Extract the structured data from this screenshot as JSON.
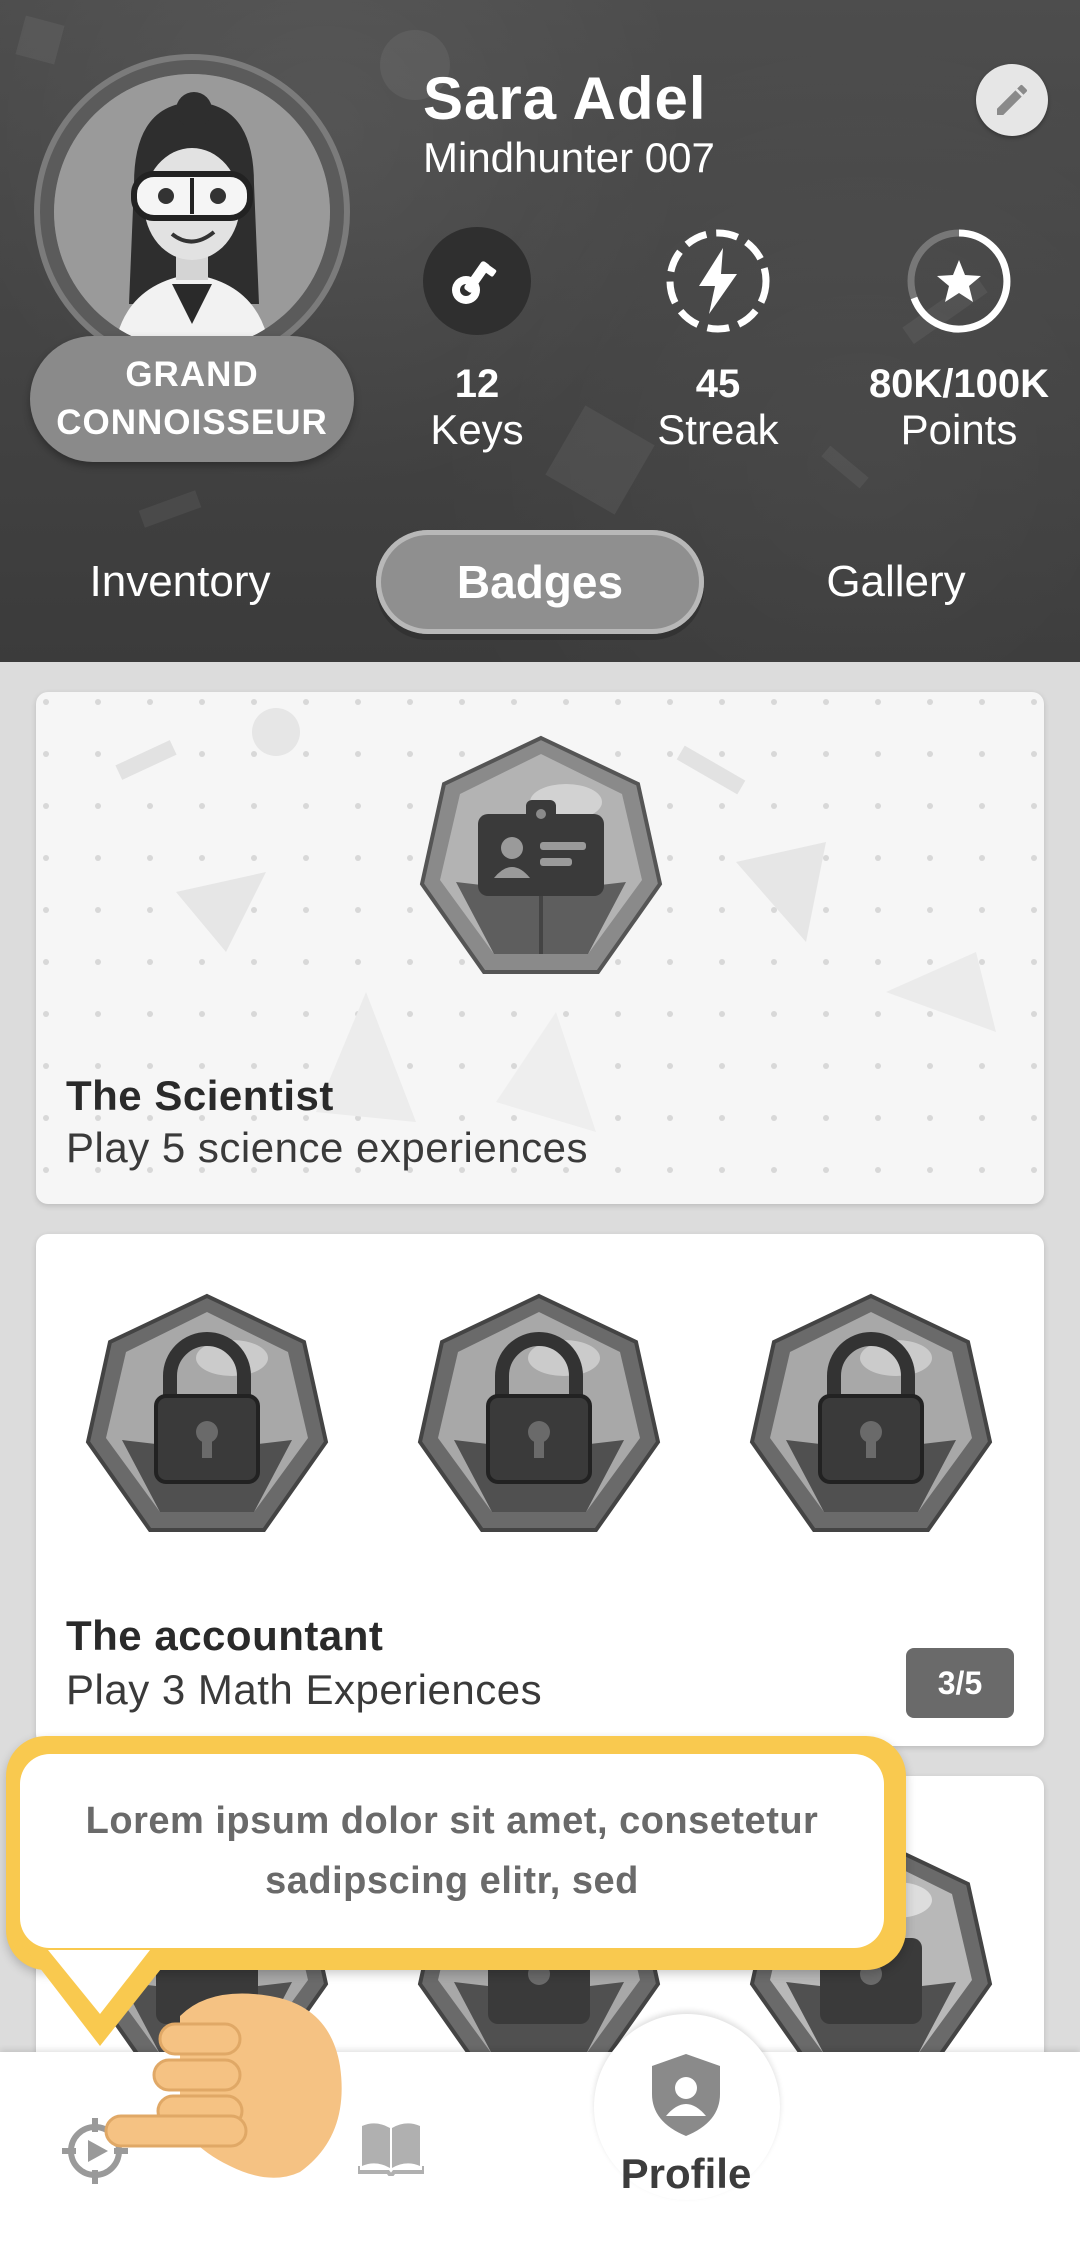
{
  "profile": {
    "name": "Sara Adel",
    "handle": "Mindhunter 007",
    "rank": "GRAND CONNOISSEUR"
  },
  "stats": [
    {
      "value": "12",
      "label": "Keys",
      "icon": "key-icon"
    },
    {
      "value": "45",
      "label": "Streak",
      "icon": "lightning-icon"
    },
    {
      "value": "80K/100K",
      "label": "Points",
      "icon": "star-icon"
    }
  ],
  "tabs": [
    {
      "label": "Inventory",
      "active": false
    },
    {
      "label": "Badges",
      "active": true
    },
    {
      "label": "Gallery",
      "active": false
    }
  ],
  "badges": [
    {
      "title": "The Scientist",
      "subtitle": "Play 5 science experiences",
      "icon": "id-card-icon"
    },
    {
      "title": "The accountant",
      "subtitle": "Play 3 Math Experiences",
      "progress": "3/5",
      "icon": "lock-icon"
    }
  ],
  "tooltip": {
    "text": "Lorem ipsum dolor sit amet, consetetur sadipscing elitr, sed"
  },
  "bottom_nav": {
    "active_label": "Profile",
    "items": [
      "target-icon",
      "book-icon",
      "profile-shield-icon"
    ]
  },
  "colors": {
    "header_bg": "#4a4a4a",
    "tooltip_border": "#f9c94f",
    "hand": "#f5c283"
  }
}
